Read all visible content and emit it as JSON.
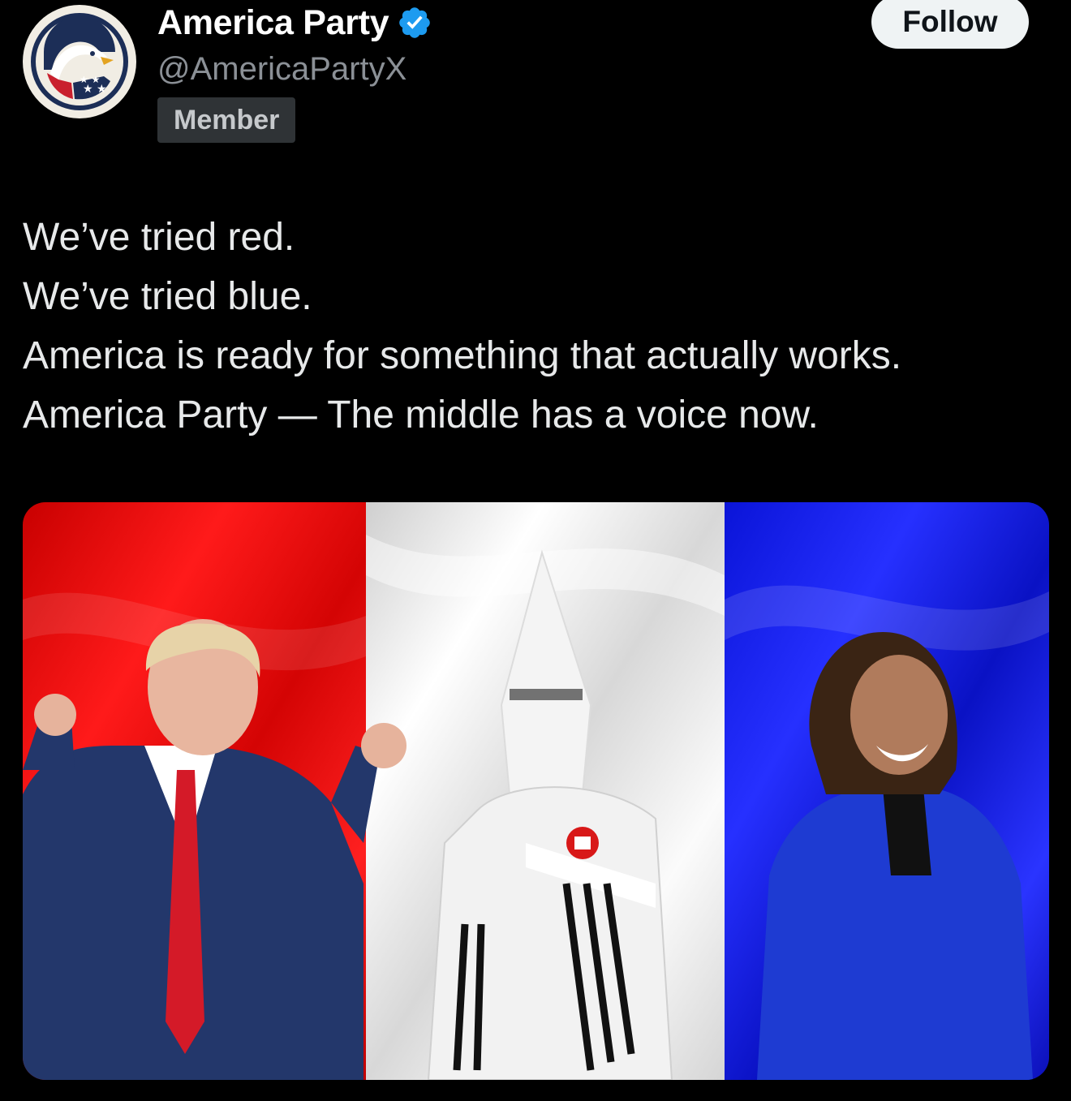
{
  "post": {
    "author": {
      "display_name": "America Party",
      "handle": "@AmericaPartyX",
      "badge": "Member",
      "verified": true,
      "avatar_icon": "eagle-star-logo-icon"
    },
    "follow_label": "Follow",
    "text_lines": [
      "We’ve tried red.",
      "We’ve tried blue.",
      "America is ready for something that actually works.",
      "America Party — The middle has a voice now."
    ],
    "media": {
      "panels": [
        "red",
        "white",
        "blue"
      ]
    }
  },
  "colors": {
    "background": "#000000",
    "verified": "#1d9bf0",
    "panel_red": "#e30b0b",
    "panel_white": "#ececec",
    "panel_blue": "#0b14e6"
  }
}
